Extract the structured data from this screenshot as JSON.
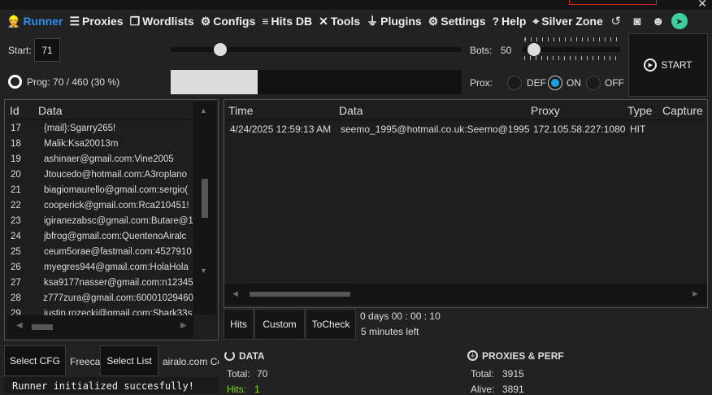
{
  "nav": {
    "items": [
      {
        "label": "Runner",
        "icon": "worker-icon",
        "glyph": "👷"
      },
      {
        "label": "Proxies",
        "icon": "server-icon",
        "glyph": "☰"
      },
      {
        "label": "Wordlists",
        "icon": "files-icon",
        "glyph": "❐"
      },
      {
        "label": "Configs",
        "icon": "cog-icon",
        "glyph": "⚙"
      },
      {
        "label": "Hits DB",
        "icon": "database-icon",
        "glyph": "≡"
      },
      {
        "label": "Tools",
        "icon": "tools-icon",
        "glyph": "✕"
      },
      {
        "label": "Plugins",
        "icon": "plug-icon",
        "glyph": "⏚"
      },
      {
        "label": "Settings",
        "icon": "gear-icon",
        "glyph": "⚙"
      },
      {
        "label": "Help",
        "icon": "question-icon",
        "glyph": "?"
      },
      {
        "label": "Silver Zone",
        "icon": "location-icon",
        "glyph": "⌖"
      }
    ],
    "tools": [
      {
        "icon": "history-icon",
        "glyph": "↺"
      },
      {
        "icon": "camera-icon",
        "glyph": "◙"
      },
      {
        "icon": "discord-icon",
        "glyph": "☻"
      },
      {
        "icon": "telegram-icon",
        "glyph": "➤"
      }
    ]
  },
  "controls": {
    "start_label": "Start:",
    "start_value": "71",
    "bots_label": "Bots:",
    "bots_value": "50",
    "bots_fraction": 0.1,
    "start_fraction": 0.17,
    "prog_text": "Prog: 70  /  460  (30 %)",
    "progress_percent": 30,
    "prox_label": "Prox:",
    "prox_options": [
      "DEF",
      "ON",
      "OFF"
    ],
    "prox_selected": "ON",
    "start_button": "START"
  },
  "data_list": {
    "headers": [
      "Id",
      "Data"
    ],
    "rows": [
      {
        "id": "17",
        "data": "{mail}:Sgarry265!"
      },
      {
        "id": "18",
        "data": "Malik:Ksa20013m"
      },
      {
        "id": "19",
        "data": "ashinaer@gmail.com:Vine2005"
      },
      {
        "id": "20",
        "data": "Jtoucedo@hotmail.com:A3roplano"
      },
      {
        "id": "21",
        "data": "biagiomaurello@gmail.com:sergio("
      },
      {
        "id": "22",
        "data": "cooperick@gmail.com:Rca210451!"
      },
      {
        "id": "23",
        "data": "igiranezabsc@gmail.com:Butare@1"
      },
      {
        "id": "24",
        "data": "jbfrog@gmail.com:QuentenoAiralc"
      },
      {
        "id": "25",
        "data": "ceum5orae@fastmail.com:4527910"
      },
      {
        "id": "26",
        "data": "myegres944@gmail.com:HolaHola"
      },
      {
        "id": "27",
        "data": "ksa9177nasser@gmail.com:n12345"
      },
      {
        "id": "28",
        "data": "z777zura@gmail.com:60001029460"
      },
      {
        "id": "29",
        "data": "justin.rozecki@gmail.com:Shark33s"
      }
    ]
  },
  "hits": {
    "headers": [
      "Time",
      "Data",
      "Proxy",
      "Type",
      "Capture"
    ],
    "rows": [
      {
        "time": "4/24/2025 12:59:13 AM",
        "data": "seemo_1995@hotmail.co.uk:Seemo@1995",
        "proxy": "172.105.58.227:1080",
        "type": "HIT",
        "capture": ""
      }
    ]
  },
  "tabs": [
    "Hits",
    "Custom",
    "ToCheck"
  ],
  "timer": {
    "elapsed": "0  days  00  :  00  :  10",
    "left": "5 minutes left"
  },
  "selectors": {
    "cfg_button": "Select CFG",
    "cfg_name": "Freecas",
    "list_button": "Select List",
    "list_name": "airalo.com Co"
  },
  "log": "Runner initialized succesfully!",
  "stats": {
    "data_title": "DATA",
    "data_total_label": "Total:",
    "data_total": "70",
    "hits_label": "Hits:",
    "hits": "1",
    "proxies_title": "PROXIES & PERF",
    "proxy_total_label": "Total:",
    "proxy_total": "3915",
    "alive_label": "Alive:",
    "alive": "3891"
  },
  "colors": {
    "accent": "#2a8ff0",
    "hits": "#7fdc1e",
    "radio": "#1aa0e0"
  }
}
